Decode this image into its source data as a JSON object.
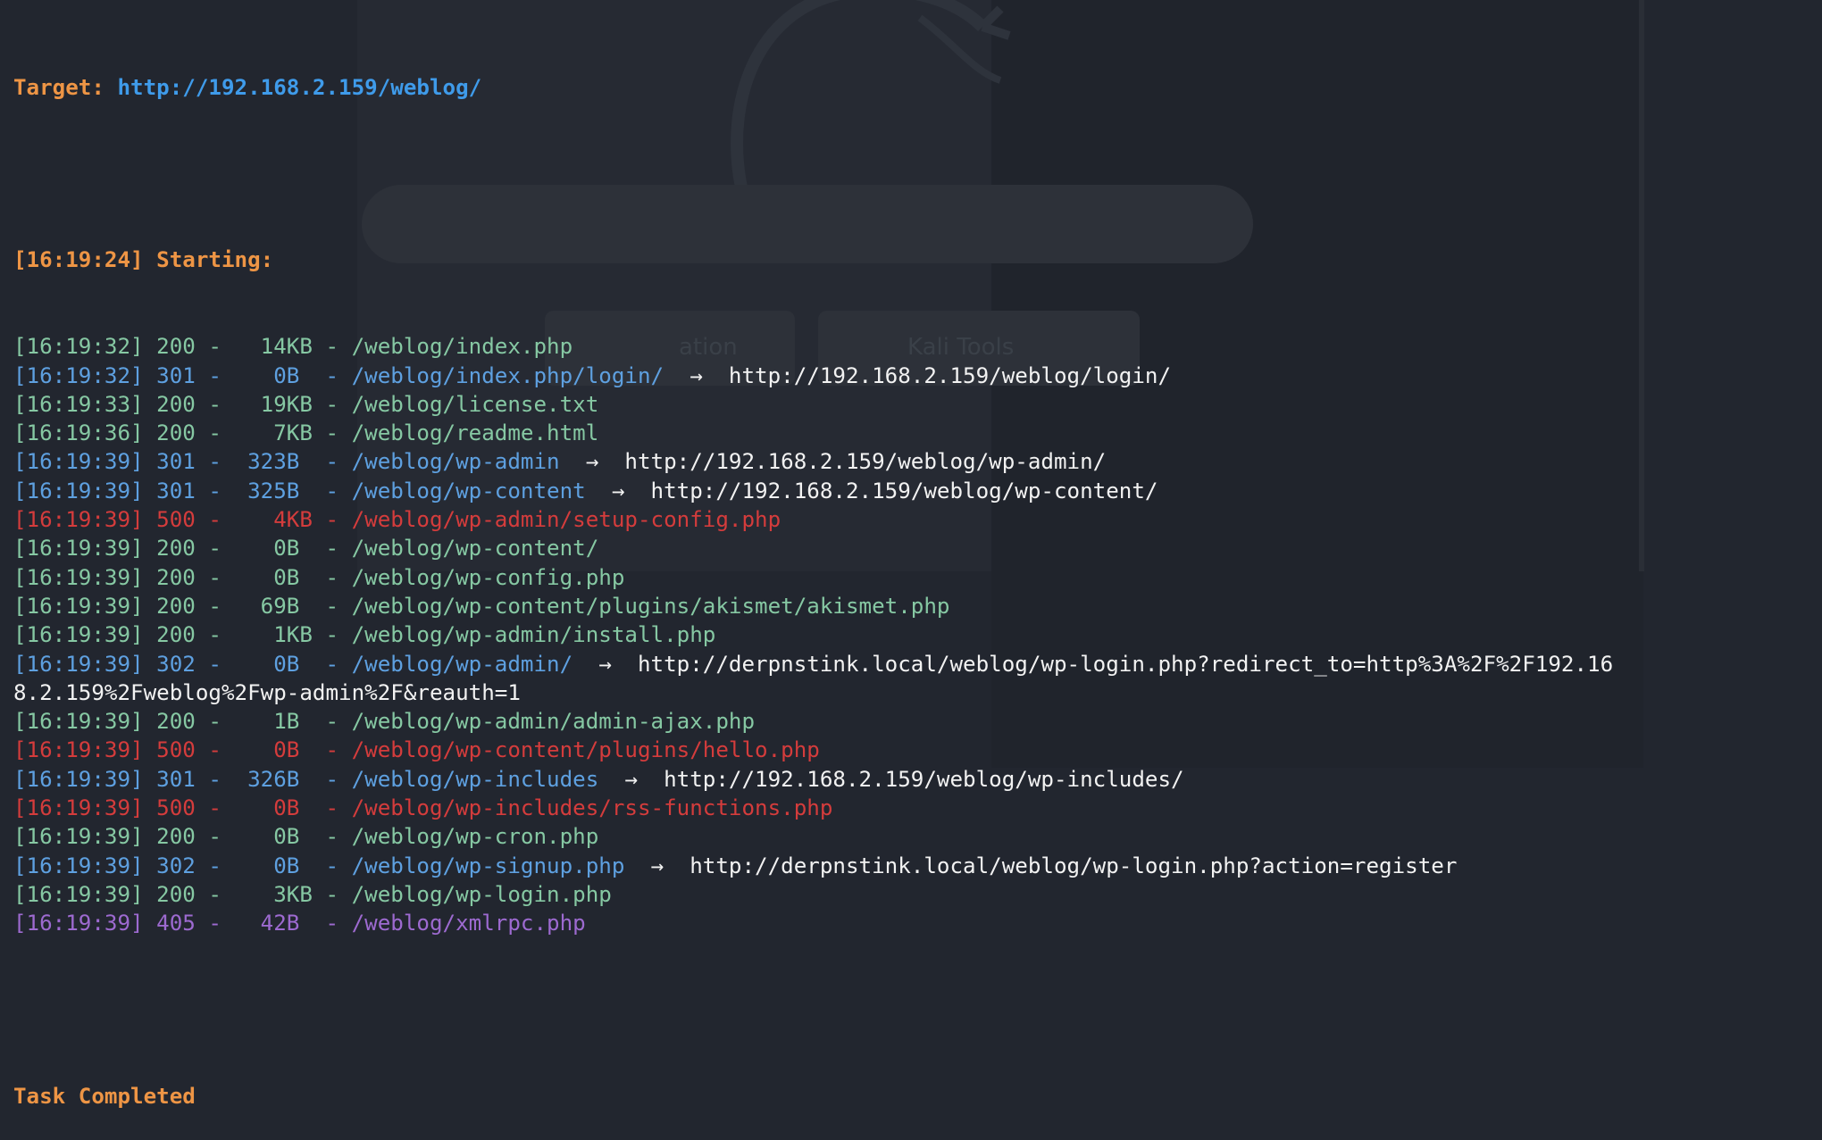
{
  "terminal": {
    "target_label": "Target:",
    "target_url": "http://192.168.2.159/weblog/",
    "start_line": "[16:19:24] Starting:",
    "arrow": "→",
    "entries": [
      {
        "text": "[16:19:32] 200 -   14KB - /weblog/index.php",
        "redirect": "",
        "status": "200"
      },
      {
        "text": "[16:19:32] 301 -    0B  - /weblog/index.php/login/",
        "redirect": "http://192.168.2.159/weblog/login/",
        "status": "301"
      },
      {
        "text": "[16:19:33] 200 -   19KB - /weblog/license.txt",
        "redirect": "",
        "status": "200"
      },
      {
        "text": "[16:19:36] 200 -    7KB - /weblog/readme.html",
        "redirect": "",
        "status": "200"
      },
      {
        "text": "[16:19:39] 301 -  323B  - /weblog/wp-admin",
        "redirect": "http://192.168.2.159/weblog/wp-admin/",
        "status": "301"
      },
      {
        "text": "[16:19:39] 301 -  325B  - /weblog/wp-content",
        "redirect": "http://192.168.2.159/weblog/wp-content/",
        "status": "301"
      },
      {
        "text": "[16:19:39] 500 -    4KB - /weblog/wp-admin/setup-config.php",
        "redirect": "",
        "status": "500"
      },
      {
        "text": "[16:19:39] 200 -    0B  - /weblog/wp-content/",
        "redirect": "",
        "status": "200"
      },
      {
        "text": "[16:19:39] 200 -    0B  - /weblog/wp-config.php",
        "redirect": "",
        "status": "200"
      },
      {
        "text": "[16:19:39] 200 -   69B  - /weblog/wp-content/plugins/akismet/akismet.php",
        "redirect": "",
        "status": "200"
      },
      {
        "text": "[16:19:39] 200 -    1KB - /weblog/wp-admin/install.php",
        "redirect": "",
        "status": "200"
      },
      {
        "text": "[16:19:39] 302 -    0B  - /weblog/wp-admin/",
        "redirect": "http://derpnstink.local/weblog/wp-login.php?redirect_to=http%3A%2F%2F192.16",
        "status": "302"
      },
      {
        "text": "",
        "redirect": "8.2.159%2Fweblog%2Fwp-admin%2F&reauth=1",
        "status": "cont"
      },
      {
        "text": "[16:19:39] 200 -    1B  - /weblog/wp-admin/admin-ajax.php",
        "redirect": "",
        "status": "200"
      },
      {
        "text": "[16:19:39] 500 -    0B  - /weblog/wp-content/plugins/hello.php",
        "redirect": "",
        "status": "500"
      },
      {
        "text": "[16:19:39] 301 -  326B  - /weblog/wp-includes",
        "redirect": "http://192.168.2.159/weblog/wp-includes/",
        "status": "301"
      },
      {
        "text": "[16:19:39] 500 -    0B  - /weblog/wp-includes/rss-functions.php",
        "redirect": "",
        "status": "500"
      },
      {
        "text": "[16:19:39] 200 -    0B  - /weblog/wp-cron.php",
        "redirect": "",
        "status": "200"
      },
      {
        "text": "[16:19:39] 302 -    0B  - /weblog/wp-signup.php",
        "redirect": "http://derpnstink.local/weblog/wp-login.php?action=register",
        "status": "302"
      },
      {
        "text": "[16:19:39] 200 -    3KB - /weblog/wp-login.php",
        "redirect": "",
        "status": "200"
      },
      {
        "text": "[16:19:39] 405 -   42B  - /weblog/xmlrpc.php",
        "redirect": "",
        "status": "405"
      }
    ],
    "completed": "Task Completed"
  },
  "background": {
    "tile_1_label": "ation",
    "tile_2_label": "Kali Tools"
  },
  "colors": {
    "background": "#22262f",
    "header_orange": "#ee9545",
    "url_blue": "#3f9bea",
    "status_200": "#86c8a3",
    "status_3xx": "#5ea0e0",
    "status_500": "#d43c3c",
    "status_405": "#9d6ad0",
    "redirect_text": "#f2f2f2"
  }
}
